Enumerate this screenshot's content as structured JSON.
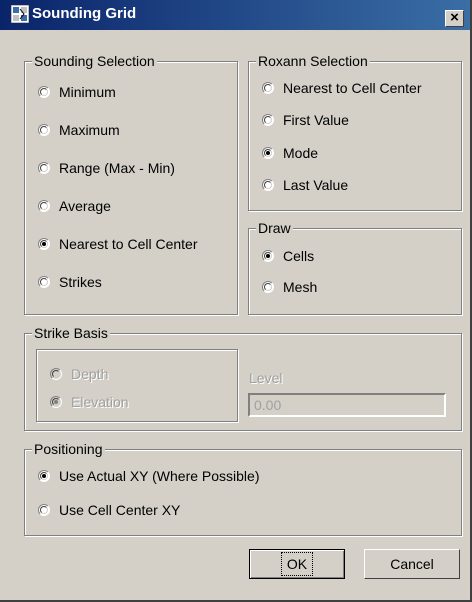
{
  "window": {
    "title": "Sounding Grid",
    "close_glyph": "×"
  },
  "sounding_selection": {
    "legend": "Sounding Selection",
    "options": [
      "Minimum",
      "Maximum",
      "Range (Max - Min)",
      "Average",
      "Nearest to Cell Center",
      "Strikes"
    ],
    "selected": "Nearest to Cell Center"
  },
  "roxann_selection": {
    "legend": "Roxann Selection",
    "options": [
      "Nearest to Cell Center",
      "First Value",
      "Mode",
      "Last Value"
    ],
    "selected": "Mode"
  },
  "draw": {
    "legend": "Draw",
    "options": [
      "Cells",
      "Mesh"
    ],
    "selected": "Cells"
  },
  "strike_basis": {
    "legend": "Strike Basis",
    "options": [
      "Depth",
      "Elevation"
    ],
    "selected": "Elevation",
    "enabled": false,
    "level_label": "Level",
    "level_value": "0.00"
  },
  "positioning": {
    "legend": "Positioning",
    "options": [
      "Use Actual XY (Where Possible)",
      "Use Cell Center XY"
    ],
    "selected": "Use Actual XY (Where Possible)"
  },
  "buttons": {
    "ok": "OK",
    "cancel": "Cancel"
  },
  "icons": {
    "app": "grid-app-icon",
    "close": "close-icon"
  },
  "colors": {
    "title_bar": "#0a246a",
    "title_bar_gradient_end": "#3a6ea5",
    "dialog_face": "#d4d0c8",
    "disabled_text": "#a0a0a0"
  }
}
